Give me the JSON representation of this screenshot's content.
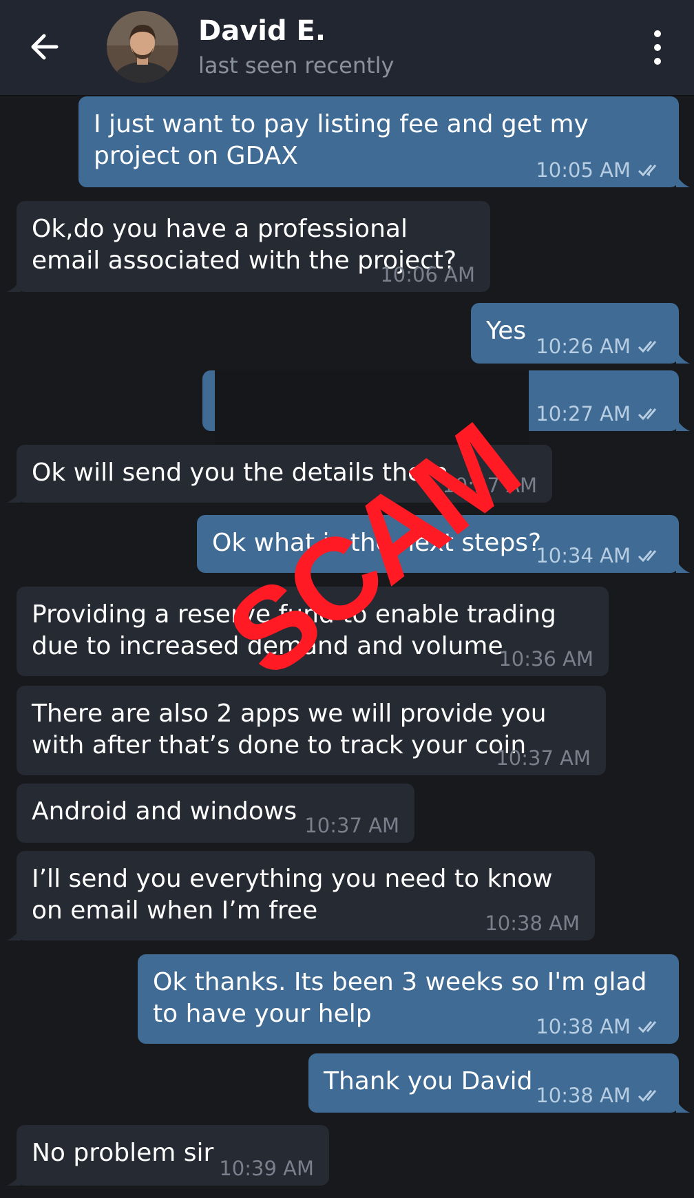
{
  "header": {
    "name": "David E.",
    "status": "last seen recently"
  },
  "messages": [
    {
      "dir": "out",
      "text": "I just want to pay listing fee and get my project on GDAX",
      "time": "10:05 AM",
      "read": true
    },
    {
      "dir": "in",
      "text": "Ok,do you have a professional email associated with the project?",
      "time": "10:06 AM"
    },
    {
      "dir": "out",
      "text": "Yes",
      "time": "10:26 AM",
      "read": true
    },
    {
      "dir": "out",
      "text": "",
      "time": "10:27 AM",
      "read": true,
      "redacted": true
    },
    {
      "dir": "in",
      "text": "Ok will send you the details there",
      "time": "10:27 AM"
    },
    {
      "dir": "out",
      "text": "Ok what is the next steps?",
      "time": "10:34 AM",
      "read": true
    },
    {
      "dir": "in",
      "text": "Providing a reserve fund to enable trading due to increased demand and volume",
      "time": "10:36 AM"
    },
    {
      "dir": "in",
      "text": "There are also 2 apps we will provide you with after that’s done to track your coin",
      "time": "10:37 AM"
    },
    {
      "dir": "in",
      "text": "Android and windows",
      "time": "10:37 AM"
    },
    {
      "dir": "in",
      "text": "I’ll send you everything you need to know on email when I’m free",
      "time": "10:38 AM"
    },
    {
      "dir": "out",
      "text": "Ok thanks. Its been 3 weeks so I'm glad to have your help",
      "time": "10:38 AM",
      "read": true
    },
    {
      "dir": "out",
      "text": "Thank you David",
      "time": "10:38 AM",
      "read": true
    },
    {
      "dir": "in",
      "text": "No problem sir",
      "time": "10:39 AM"
    }
  ],
  "overlay": {
    "stamp": "SCAM",
    "color": "#ff1a24"
  },
  "colors": {
    "background": "#18191d",
    "header": "#222630",
    "outgoing_bubble": "#3f6b94",
    "incoming_bubble": "#262a33"
  },
  "icons": {
    "back": "arrow-left-icon",
    "menu": "more-vertical-icon",
    "read": "double-check-icon"
  }
}
